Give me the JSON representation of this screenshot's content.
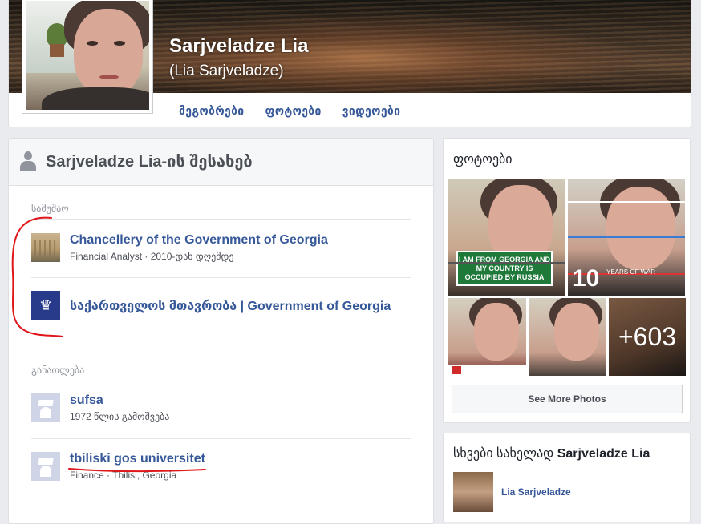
{
  "profile": {
    "name": "Sarjveladze Lia",
    "alternate_name": "(Lia Sarjveladze)"
  },
  "tabs": [
    "მეგობრები",
    "ფოტოები",
    "ვიდეოები"
  ],
  "about": {
    "title": "Sarjveladze Lia-ის შესახებ",
    "work_label": "სამუშაო",
    "work": [
      {
        "title": "Chancellery of the Government of Georgia",
        "subtitle": "Financial Analyst · 2010-დან დღემდე"
      },
      {
        "title": "საქართველოს მთავრობა | Government of Georgia",
        "subtitle": ""
      }
    ],
    "education_label": "განათლება",
    "education": [
      {
        "title": "sufsa",
        "subtitle": "1972 წლის გამოშვება"
      },
      {
        "title": "tbiliski gos universitet",
        "subtitle": "Finance · Tbilisi, Georgia"
      }
    ]
  },
  "photos": {
    "title": "ფოტოები",
    "sign_text": "I AM FROM GEORGIA AND MY COUNTRY IS OCCUPIED BY RUSSIA",
    "ten": "10",
    "years_of_war": "YEARS OF WAR",
    "more_count": "+603",
    "see_more": "See More Photos"
  },
  "others": {
    "title_prefix": "სხვები სახელად ",
    "title_name": "Sarjveladze Lia",
    "person_name": "Lia Sarjveladze"
  },
  "colors": {
    "link": "#365899",
    "annotation": "#e0161b",
    "gov_logo": "#283a8a",
    "sign_green": "#1f7a3a"
  }
}
